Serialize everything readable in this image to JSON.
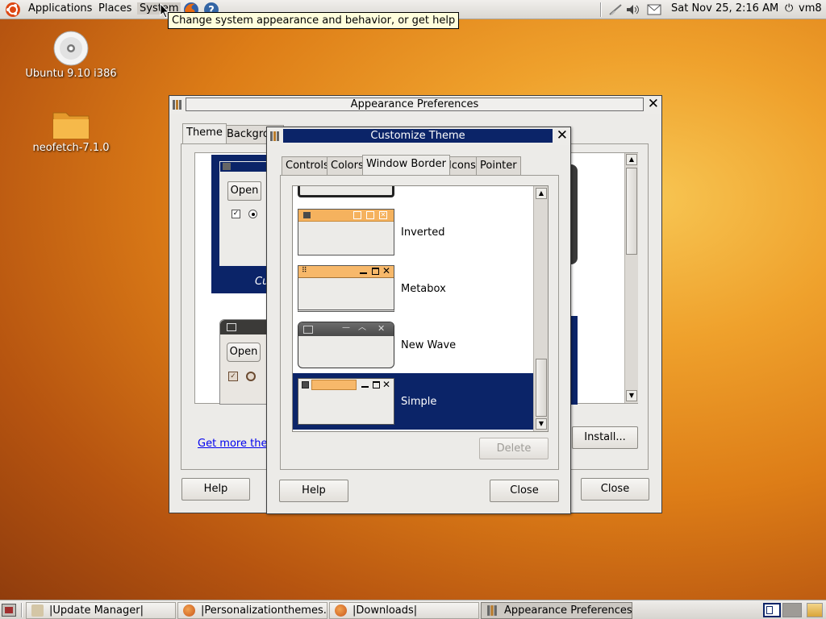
{
  "top_panel": {
    "menus": [
      "Applications",
      "Places",
      "System"
    ],
    "tooltip": "Change system appearance and behavior, or get help",
    "clock": "Sat Nov 25,  2:16 AM",
    "user": "vm8"
  },
  "desktop": {
    "icons": [
      {
        "label": "Ubuntu 9.10 i386",
        "icon": "cd-disc-icon"
      },
      {
        "label": "neofetch-7.1.0",
        "icon": "folder-icon"
      }
    ]
  },
  "appearance": {
    "title": "Appearance Preferences",
    "tabs": [
      "Theme",
      "Backgro"
    ],
    "preview": {
      "open_label": "Open",
      "caption": "Cu"
    },
    "get_more_link": "Get more them",
    "install_label": "Install...",
    "help_label": "Help",
    "close_label": "Close"
  },
  "customize": {
    "title": "Customize Theme",
    "tabs": [
      "Controls",
      "Colors",
      "Window Border",
      "Icons",
      "Pointer"
    ],
    "active_tab": "Window Border",
    "themes": [
      {
        "name": "Inverted",
        "selected": false
      },
      {
        "name": "Metabox",
        "selected": false
      },
      {
        "name": "New Wave",
        "selected": false
      },
      {
        "name": "Simple",
        "selected": true
      }
    ],
    "delete_label": "Delete",
    "help_label": "Help",
    "close_label": "Close"
  },
  "taskbar": {
    "tasks": [
      "|Update Manager|",
      "|Personalizationthemes...",
      "|Downloads|",
      "Appearance Preferences"
    ],
    "active_task": "Appearance Preferences"
  }
}
